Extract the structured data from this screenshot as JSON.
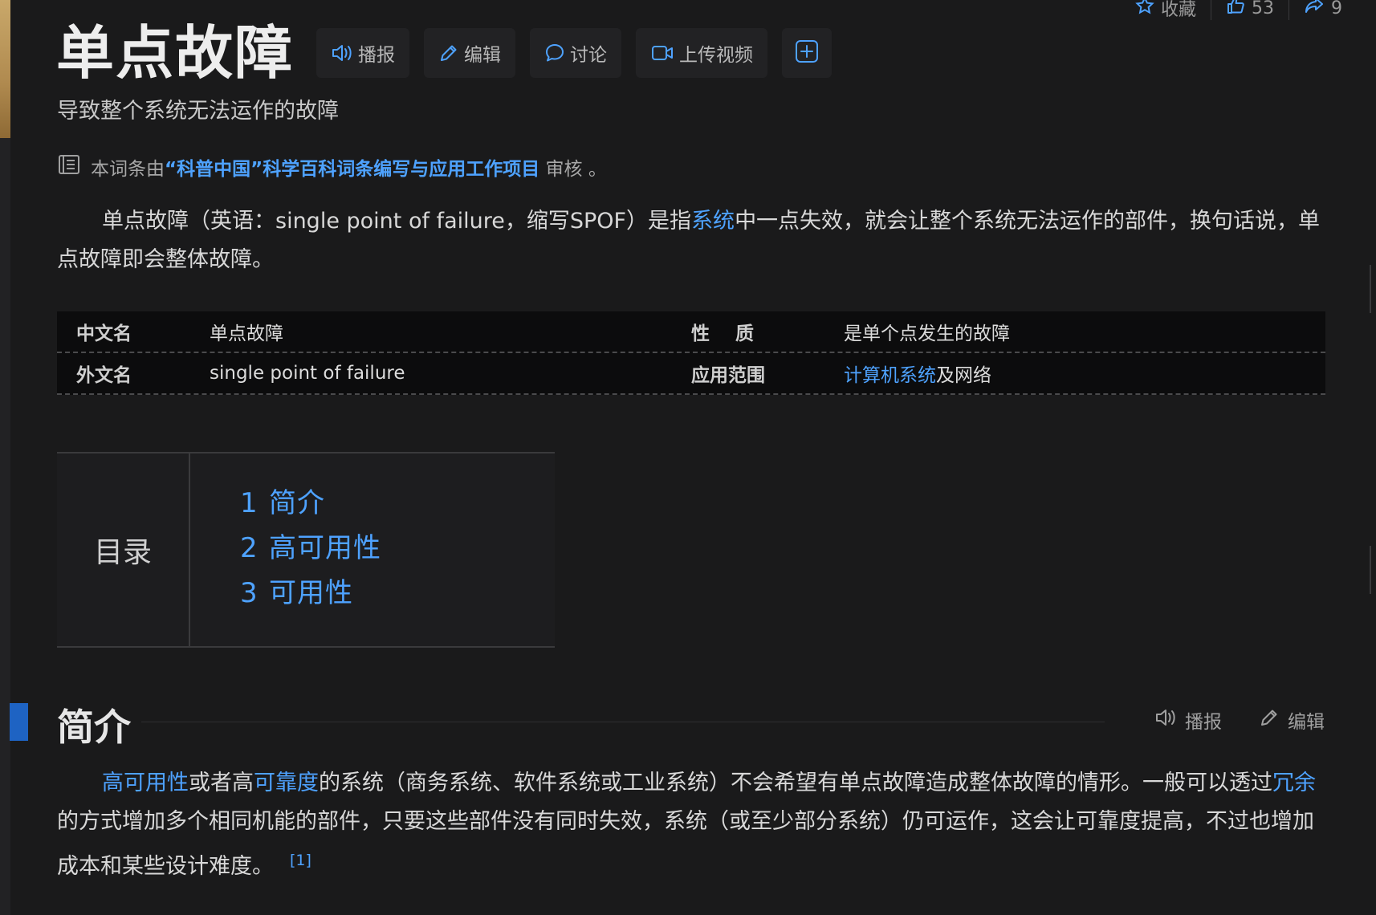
{
  "stats": {
    "favorite_label": "收藏",
    "likes_count": "53",
    "shares_count": "9"
  },
  "header": {
    "title": "单点故障",
    "toolbar": {
      "listen_label": "播报",
      "edit_label": "编辑",
      "discuss_label": "讨论",
      "upload_video_label": "上传视频"
    },
    "subtitle": "导致整个系统无法运作的故障"
  },
  "review": {
    "prefix": "本词条由",
    "project": "“科普中国”科学百科词条编写与应用工作项目",
    "suffix": "审核 。"
  },
  "intro": {
    "part1": "单点故障（英语：single point of failure，缩写SPOF）是指",
    "link1": "系统",
    "part2": "中一点失效，就会让整个系统无法运作的部件，换句话说，单点故障即会整体故障。"
  },
  "info_table": {
    "rows": [
      {
        "k1": "中文名",
        "v1": "单点故障",
        "k2": "性    质",
        "v2": "是单个点发生的故障"
      },
      {
        "k1": "外文名",
        "v1": "single point of failure",
        "k2": "应用范围",
        "v2_link": "计算机系统",
        "v2_rest": "及网络"
      }
    ]
  },
  "toc": {
    "label": "目录",
    "items": [
      {
        "num": "1",
        "title": "简介"
      },
      {
        "num": "2",
        "title": "高可用性"
      },
      {
        "num": "3",
        "title": "可用性"
      }
    ]
  },
  "section": {
    "title": "简介",
    "listen_label": "播报",
    "edit_label": "编辑",
    "link_high_availability": "高可用性",
    "text_a": "或者高",
    "link_reliability": "可靠度",
    "text_b": "的系统（商务系统、软件系统或工业系统）不会希望有单点故障造成整体故障的情形。一般可以透过",
    "link_redundancy": "冗余",
    "text_c": "的方式增加多个相同机能的部件，只要这些部件没有同时失效，系统（或至少部分系统）仍可运作，这会让可靠度提高，不过也增加成本和某些设计难度。",
    "ref": "[1]"
  },
  "colors": {
    "background": "#1a1a1b",
    "link": "#4ea2ff",
    "section_marker": "#1e63c3",
    "table_bg": "#0c0c0d"
  }
}
